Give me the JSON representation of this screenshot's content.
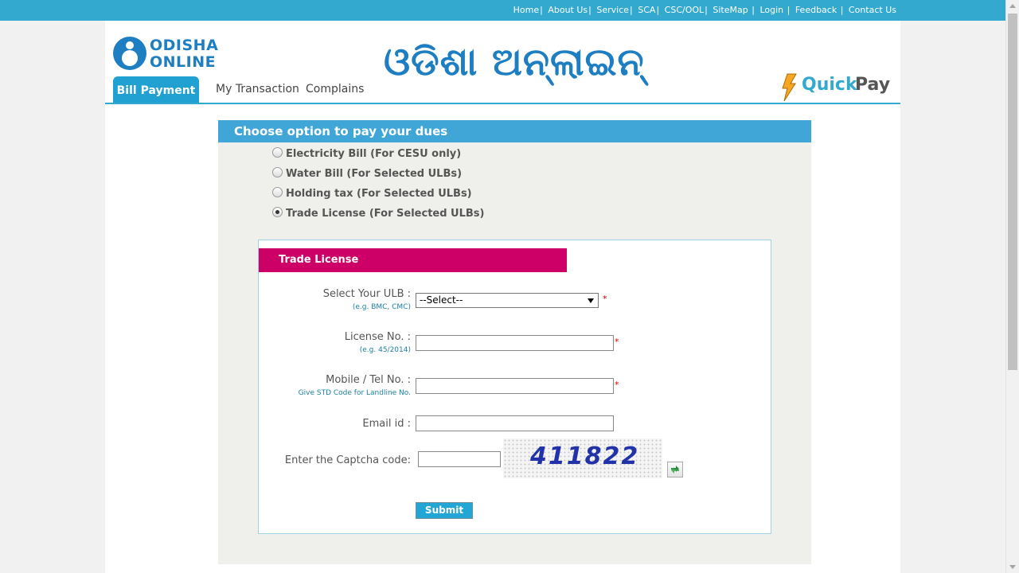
{
  "top_nav": {
    "links": [
      "Home",
      "About Us",
      "Service",
      "SCA",
      "CSC/OOL",
      "SiteMap",
      "Login",
      "Feedback",
      "Contact Us"
    ]
  },
  "header": {
    "logo_line1": "ODISHA",
    "logo_line2": "ONLINE",
    "brand_title": "ଓଡିଶା ଅନ୍‌ଲାଇନ୍",
    "quickpay_quick": "Quick",
    "quickpay_pay": "Pay"
  },
  "tabs": {
    "active": "Bill Payment",
    "my_transaction": "My Transaction",
    "complains": "Complains"
  },
  "choose": {
    "heading": "Choose option to pay your dues",
    "options": [
      {
        "label": "Electricity Bill (For CESU only)",
        "checked": false
      },
      {
        "label": "Water Bill (For Selected ULBs)",
        "checked": false
      },
      {
        "label": "Holding tax (For Selected ULBs)",
        "checked": false
      },
      {
        "label": "Trade License (For Selected ULBs)",
        "checked": true
      }
    ]
  },
  "form": {
    "title": "Trade License",
    "ulb_label": "Select Your ULB :",
    "ulb_hint": "(e.g. BMC, CMC)",
    "ulb_selected": "--Select--",
    "license_label": "License No. :",
    "license_hint": "(e.g. 45/2014)",
    "mobile_label": "Mobile / Tel No. :",
    "mobile_hint": "Give STD Code for Landline No.",
    "email_label": "Email id :",
    "captcha_label": "Enter the Captcha code:",
    "captcha_code": "411822",
    "required_mark": "*",
    "submit_label": "Submit"
  },
  "colors": {
    "topbar": "#33a9cf",
    "choose_bar": "#40a6d8",
    "form_header": "#cc0066",
    "active_tab": "#21a0d2"
  }
}
